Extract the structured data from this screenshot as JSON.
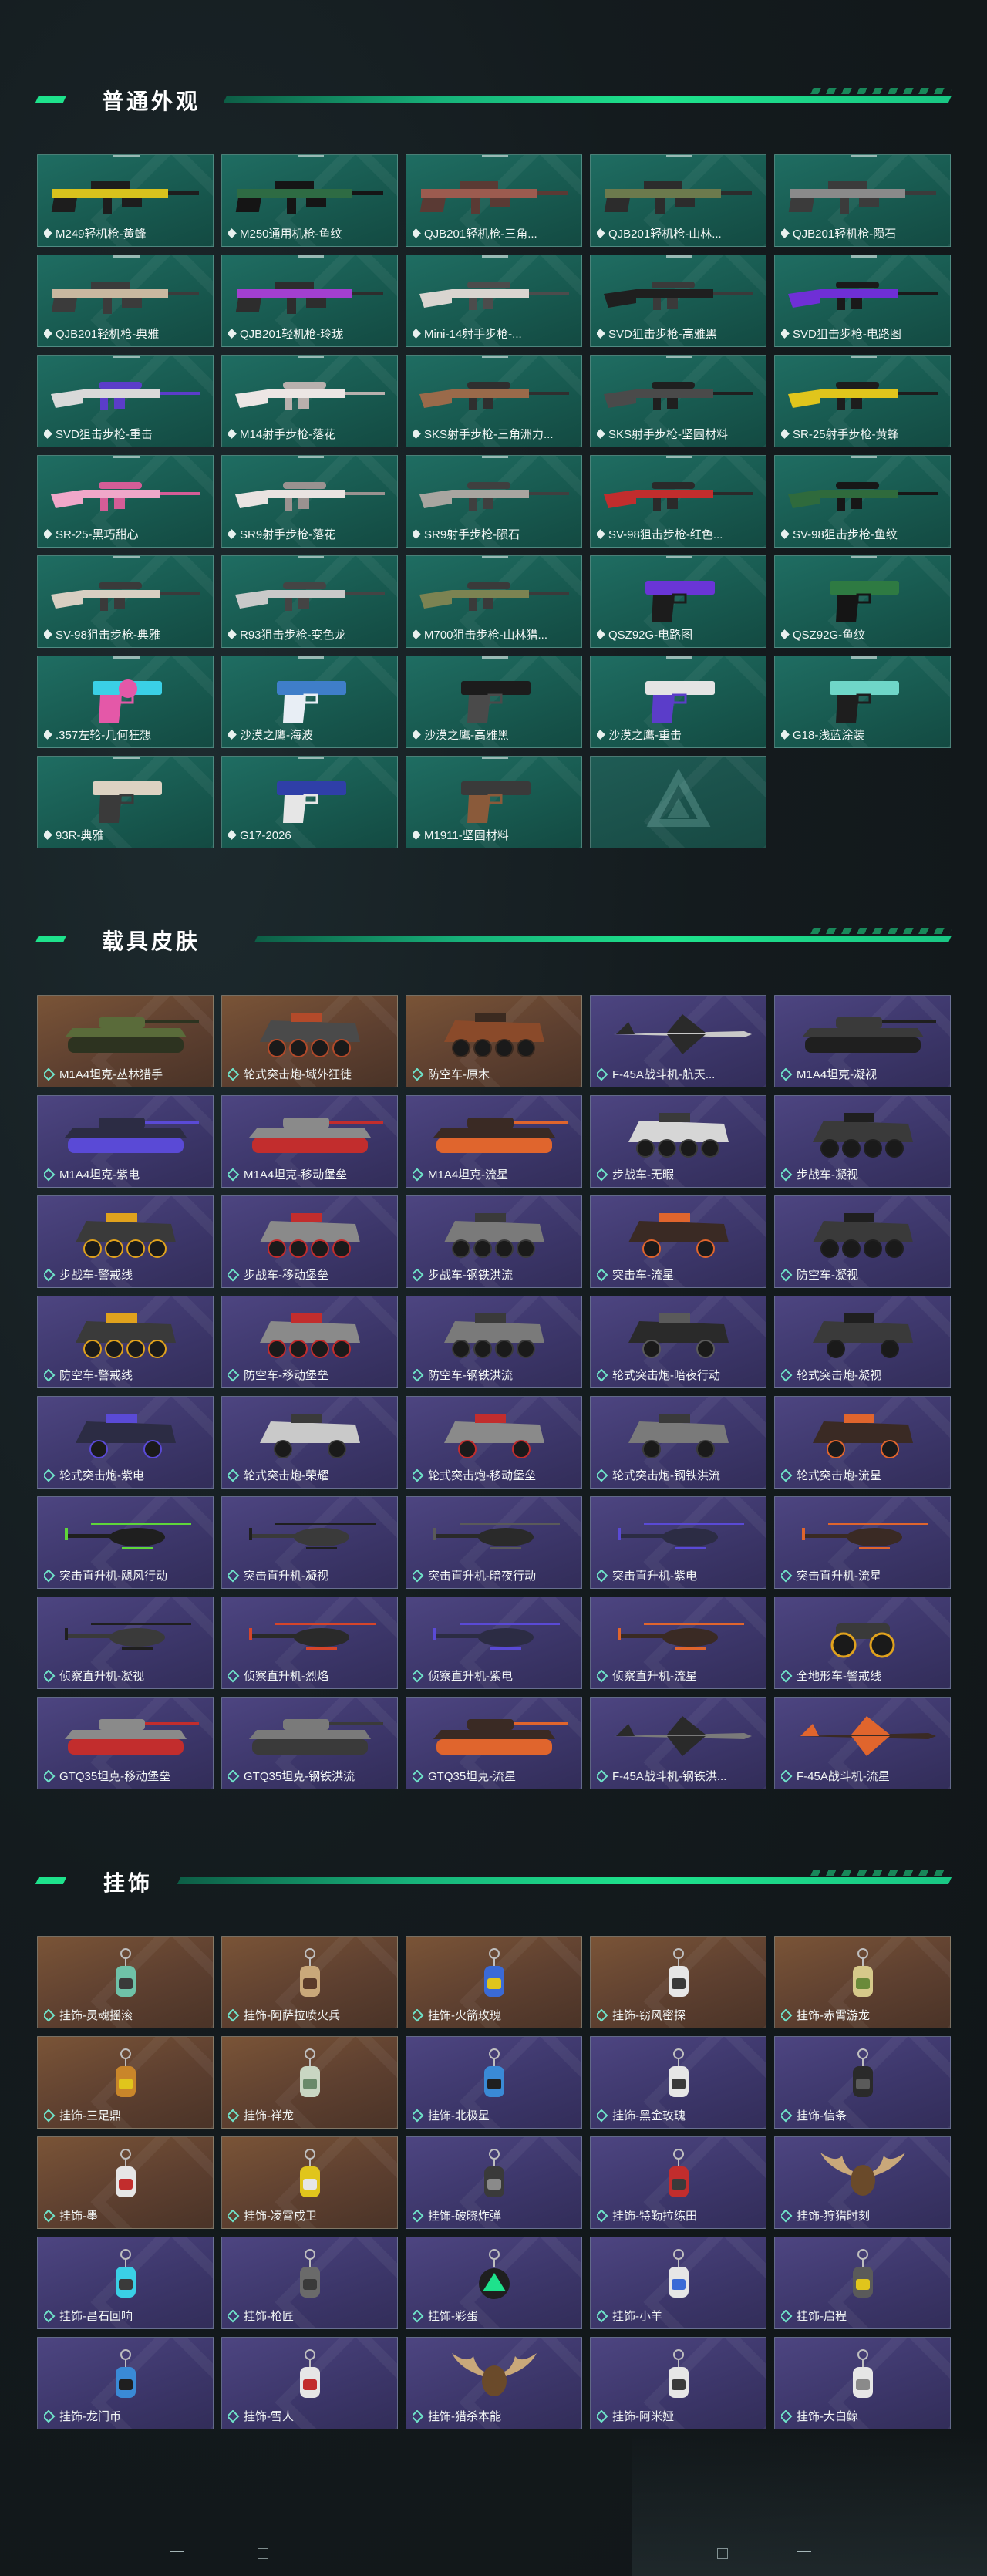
{
  "sections": [
    {
      "title": "普通外观",
      "items": [
        {
          "label": "M249轻机枪-黄蜂",
          "kind": "gun-long",
          "colors": [
            "#d8c21d",
            "#1d1d1d"
          ]
        },
        {
          "label": "M250通用机枪-鱼纹",
          "kind": "gun-long",
          "colors": [
            "#2e6b43",
            "#151515"
          ]
        },
        {
          "label": "QJB201轻机枪-三角...",
          "kind": "gun-long",
          "colors": [
            "#9c5b4f",
            "#5a3a34"
          ]
        },
        {
          "label": "QJB201轻机枪-山林...",
          "kind": "gun-long",
          "colors": [
            "#6c7a4d",
            "#2c2c2c"
          ]
        },
        {
          "label": "QJB201轻机枪-陨石",
          "kind": "gun-long",
          "colors": [
            "#8a8a8a",
            "#3b3b3b"
          ]
        },
        {
          "label": "QJB201轻机枪-典雅",
          "kind": "gun-long",
          "colors": [
            "#c9b8a0",
            "#3b3b3b"
          ]
        },
        {
          "label": "QJB201轻机枪-玲珑",
          "kind": "gun-long",
          "colors": [
            "#a33fd0",
            "#2d2d2d"
          ]
        },
        {
          "label": "Mini-14射手步枪-...",
          "kind": "gun-rifle",
          "colors": [
            "#d9d5d0",
            "#4c4c4c"
          ]
        },
        {
          "label": "SVD狙击步枪-高雅黑",
          "kind": "gun-rifle",
          "colors": [
            "#1f1f1f",
            "#3a3a3a"
          ]
        },
        {
          "label": "SVD狙击步枪-电路图",
          "kind": "gun-rifle",
          "colors": [
            "#6f2fd6",
            "#1a1a1a"
          ]
        },
        {
          "label": "SVD狙击步枪-重击",
          "kind": "gun-rifle",
          "colors": [
            "#d9d9d9",
            "#5b3dc9"
          ]
        },
        {
          "label": "M14射手步枪-落花",
          "kind": "gun-rifle",
          "colors": [
            "#ece6e4",
            "#b8b0ad"
          ]
        },
        {
          "label": "SKS射手步枪-三角洲力...",
          "kind": "gun-rifle",
          "colors": [
            "#9a6a4a",
            "#2f2f2f"
          ]
        },
        {
          "label": "SKS射手步枪-坚固材料",
          "kind": "gun-rifle",
          "colors": [
            "#4a4a4a",
            "#1f1f1f"
          ]
        },
        {
          "label": "SR-25射手步枪-黄蜂",
          "kind": "gun-rifle",
          "colors": [
            "#e0c51c",
            "#1d1d1d"
          ]
        },
        {
          "label": "SR-25-黑巧甜心",
          "kind": "gun-rifle",
          "colors": [
            "#f0a7c9",
            "#d45d97"
          ]
        },
        {
          "label": "SR9射手步枪-落花",
          "kind": "gun-rifle",
          "colors": [
            "#e9e3e1",
            "#9a9290"
          ]
        },
        {
          "label": "SR9射手步枪-陨石",
          "kind": "gun-rifle",
          "colors": [
            "#a8a5a0",
            "#3f3f3f"
          ]
        },
        {
          "label": "SV-98狙击步枪-红色...",
          "kind": "gun-rifle",
          "colors": [
            "#c22d2d",
            "#2a2a2a"
          ]
        },
        {
          "label": "SV-98狙击步枪-鱼纹",
          "kind": "gun-rifle",
          "colors": [
            "#2f6a3c",
            "#171717"
          ]
        },
        {
          "label": "SV-98狙击步枪-典雅",
          "kind": "gun-rifle",
          "colors": [
            "#d8cfc2",
            "#3a3a3a"
          ]
        },
        {
          "label": "R93狙击步枪-变色龙",
          "kind": "gun-rifle",
          "colors": [
            "#c9c9c9",
            "#444444"
          ]
        },
        {
          "label": "M700狙击步枪-山林猎...",
          "kind": "gun-rifle",
          "colors": [
            "#7c8352",
            "#3a3a3a"
          ]
        },
        {
          "label": "QSZ92G-电路图",
          "kind": "gun-pistol",
          "colors": [
            "#6a35d6",
            "#1c1c1c"
          ]
        },
        {
          "label": "QSZ92G-鱼纹",
          "kind": "gun-pistol",
          "colors": [
            "#2e7a42",
            "#151515"
          ]
        },
        {
          "label": ".357左轮-几何狂想",
          "kind": "gun-revolver",
          "colors": [
            "#3ad0e6",
            "#e458a8"
          ]
        },
        {
          "label": "沙漠之鹰-海波",
          "kind": "gun-pistol",
          "colors": [
            "#3f7ec9",
            "#e8eef5"
          ]
        },
        {
          "label": "沙漠之鹰-高雅黑",
          "kind": "gun-pistol",
          "colors": [
            "#1c1c1c",
            "#4a4a4a"
          ]
        },
        {
          "label": "沙漠之鹰-重击",
          "kind": "gun-pistol",
          "colors": [
            "#e4e4e4",
            "#5b3dc9"
          ]
        },
        {
          "label": "G18-浅蓝涂装",
          "kind": "gun-pistol",
          "colors": [
            "#6fd6c8",
            "#1e1e1e"
          ]
        },
        {
          "label": "93R-典雅",
          "kind": "gun-pistol",
          "colors": [
            "#ddd2c2",
            "#3a3a3a"
          ]
        },
        {
          "label": "G17-2026",
          "kind": "gun-pistol",
          "colors": [
            "#2f3fa8",
            "#e6e6e6"
          ]
        },
        {
          "label": "M1911-坚固材料",
          "kind": "gun-pistol",
          "colors": [
            "#3a3a3a",
            "#8a5a3a"
          ]
        },
        {
          "label": "",
          "kind": "empty",
          "colors": [
            "#9fd9cf",
            "#9fd9cf"
          ]
        }
      ]
    },
    {
      "title": "载具皮肤",
      "items": [
        {
          "label": "M1A4坦克-丛林猎手",
          "kind": "tank",
          "bg": "orange",
          "colors": [
            "#5a6b3a",
            "#2d3320"
          ]
        },
        {
          "label": "轮式突击炮-域外狂徒",
          "kind": "apc",
          "bg": "orange",
          "colors": [
            "#4a4a4a",
            "#b34a2a"
          ]
        },
        {
          "label": "防空车-原木",
          "kind": "apc",
          "bg": "orange",
          "colors": [
            "#8a4a2a",
            "#3b2a20"
          ]
        },
        {
          "label": "F-45A战斗机-航天...",
          "kind": "jet",
          "bg": "purple",
          "colors": [
            "#c9c9c9",
            "#2a2a2a"
          ]
        },
        {
          "label": "M1A4坦克-凝视",
          "kind": "tank",
          "bg": "purple",
          "colors": [
            "#3a3a3a",
            "#1f1f1f"
          ]
        },
        {
          "label": "M1A4坦克-紫电",
          "kind": "tank",
          "bg": "purple",
          "colors": [
            "#2c2c44",
            "#5a4ad6"
          ]
        },
        {
          "label": "M1A4坦克-移动堡垒",
          "kind": "tank",
          "bg": "purple",
          "colors": [
            "#8a8a8a",
            "#c22d2d"
          ]
        },
        {
          "label": "M1A4坦克-流星",
          "kind": "tank",
          "bg": "purple",
          "colors": [
            "#3a2a24",
            "#e0652d"
          ]
        },
        {
          "label": "步战车-无暇",
          "kind": "apc",
          "bg": "purple",
          "colors": [
            "#d6d6d6",
            "#3a3a3a"
          ]
        },
        {
          "label": "步战车-凝视",
          "kind": "apc",
          "bg": "purple",
          "colors": [
            "#3a3a3a",
            "#1f1f1f"
          ]
        },
        {
          "label": "步战车-警戒线",
          "kind": "apc",
          "bg": "purple",
          "colors": [
            "#3a3a3a",
            "#e0a21d"
          ]
        },
        {
          "label": "步战车-移动堡垒",
          "kind": "apc",
          "bg": "purple",
          "colors": [
            "#8a8a8a",
            "#c22d2d"
          ]
        },
        {
          "label": "步战车-钢铁洪流",
          "kind": "apc",
          "bg": "purple",
          "colors": [
            "#7a7a7a",
            "#3a3a3a"
          ]
        },
        {
          "label": "突击车-流星",
          "kind": "truck",
          "bg": "purple",
          "colors": [
            "#3a2a24",
            "#e0652d"
          ]
        },
        {
          "label": "防空车-凝视",
          "kind": "apc",
          "bg": "purple",
          "colors": [
            "#3a3a3a",
            "#1f1f1f"
          ]
        },
        {
          "label": "防空车-警戒线",
          "kind": "apc",
          "bg": "purple",
          "colors": [
            "#3a3a3a",
            "#e0a21d"
          ]
        },
        {
          "label": "防空车-移动堡垒",
          "kind": "apc",
          "bg": "purple",
          "colors": [
            "#8a8a8a",
            "#c22d2d"
          ]
        },
        {
          "label": "防空车-钢铁洪流",
          "kind": "apc",
          "bg": "purple",
          "colors": [
            "#7a7a7a",
            "#3a3a3a"
          ]
        },
        {
          "label": "轮式突击炮-暗夜行动",
          "kind": "truck",
          "bg": "purple",
          "colors": [
            "#2a2a2a",
            "#5a5a5a"
          ]
        },
        {
          "label": "轮式突击炮-凝视",
          "kind": "truck",
          "bg": "purple",
          "colors": [
            "#3a3a3a",
            "#1f1f1f"
          ]
        },
        {
          "label": "轮式突击炮-紫电",
          "kind": "truck",
          "bg": "purple",
          "colors": [
            "#2c2c44",
            "#5a4ad6"
          ]
        },
        {
          "label": "轮式突击炮-荣耀",
          "kind": "truck",
          "bg": "purple",
          "colors": [
            "#c9c9c9",
            "#3a3a3a"
          ]
        },
        {
          "label": "轮式突击炮-移动堡垒",
          "kind": "truck",
          "bg": "purple",
          "colors": [
            "#8a8a8a",
            "#c22d2d"
          ]
        },
        {
          "label": "轮式突击炮-钢铁洪流",
          "kind": "truck",
          "bg": "purple",
          "colors": [
            "#7a7a7a",
            "#3a3a3a"
          ]
        },
        {
          "label": "轮式突击炮-流星",
          "kind": "truck",
          "bg": "purple",
          "colors": [
            "#3a2a24",
            "#e0652d"
          ]
        },
        {
          "label": "突击直升机-飓风行动",
          "kind": "heli",
          "bg": "purple",
          "colors": [
            "#1f1f1f",
            "#5fd63a"
          ]
        },
        {
          "label": "突击直升机-凝视",
          "kind": "heli",
          "bg": "purple",
          "colors": [
            "#3a3a3a",
            "#1f1f1f"
          ]
        },
        {
          "label": "突击直升机-暗夜行动",
          "kind": "heli",
          "bg": "purple",
          "colors": [
            "#2a2a2a",
            "#5a5a5a"
          ]
        },
        {
          "label": "突击直升机-紫电",
          "kind": "heli",
          "bg": "purple",
          "colors": [
            "#2c2c44",
            "#5a4ad6"
          ]
        },
        {
          "label": "突击直升机-流星",
          "kind": "heli",
          "bg": "purple",
          "colors": [
            "#3a2a24",
            "#e0652d"
          ]
        },
        {
          "label": "侦察直升机-凝视",
          "kind": "heli-small",
          "bg": "purple",
          "colors": [
            "#3a3a3a",
            "#1f1f1f"
          ]
        },
        {
          "label": "侦察直升机-烈焰",
          "kind": "heli-small",
          "bg": "purple",
          "colors": [
            "#2a2a2a",
            "#d6452a"
          ]
        },
        {
          "label": "侦察直升机-紫电",
          "kind": "heli-small",
          "bg": "purple",
          "colors": [
            "#2c2c44",
            "#5a4ad6"
          ]
        },
        {
          "label": "侦察直升机-流星",
          "kind": "heli-small",
          "bg": "purple",
          "colors": [
            "#3a2a24",
            "#e0652d"
          ]
        },
        {
          "label": "全地形车-警戒线",
          "kind": "atv",
          "bg": "purple",
          "colors": [
            "#3a3a3a",
            "#e0a21d"
          ]
        },
        {
          "label": "GTQ35坦克-移动堡垒",
          "kind": "tank",
          "bg": "purple",
          "colors": [
            "#8a8a8a",
            "#c22d2d"
          ]
        },
        {
          "label": "GTQ35坦克-钢铁洪流",
          "kind": "tank",
          "bg": "purple",
          "colors": [
            "#7a7a7a",
            "#3a3a3a"
          ]
        },
        {
          "label": "GTQ35坦克-流星",
          "kind": "tank",
          "bg": "purple",
          "colors": [
            "#3a2a24",
            "#e0652d"
          ]
        },
        {
          "label": "F-45A战斗机-钢铁洪...",
          "kind": "jet",
          "bg": "purple",
          "colors": [
            "#7a7a7a",
            "#2a2a2a"
          ]
        },
        {
          "label": "F-45A战斗机-流星",
          "kind": "jet",
          "bg": "purple",
          "colors": [
            "#3a2a24",
            "#e0652d"
          ]
        }
      ]
    },
    {
      "title": "挂饰",
      "items": [
        {
          "label": "挂饰-灵魂摇滚",
          "kind": "charm",
          "bg": "orange",
          "colors": [
            "#6fc2a8",
            "#3a3a3a"
          ]
        },
        {
          "label": "挂饰-阿萨拉喷火兵",
          "kind": "charm",
          "bg": "orange",
          "colors": [
            "#c9a87a",
            "#5a3a2a"
          ]
        },
        {
          "label": "挂饰-火箭玫瑰",
          "kind": "charm",
          "bg": "orange",
          "colors": [
            "#3a6ad6",
            "#e0c51c"
          ]
        },
        {
          "label": "挂饰-窃风密探",
          "kind": "charm",
          "bg": "orange",
          "colors": [
            "#e6e6e6",
            "#3a3a3a"
          ]
        },
        {
          "label": "挂饰-赤霄游龙",
          "kind": "charm",
          "bg": "orange",
          "colors": [
            "#d6c98a",
            "#6a8a3a"
          ]
        },
        {
          "label": "挂饰-三足鼎",
          "kind": "charm",
          "bg": "orange",
          "colors": [
            "#c9862a",
            "#e0c51c"
          ]
        },
        {
          "label": "挂饰-祥龙",
          "kind": "charm",
          "bg": "orange",
          "colors": [
            "#c9d6c2",
            "#6a8a6a"
          ]
        },
        {
          "label": "挂饰-北极星",
          "kind": "charm",
          "bg": "purple",
          "colors": [
            "#3a8ad6",
            "#1f1f1f"
          ]
        },
        {
          "label": "挂饰-黑金玫瑰",
          "kind": "charm",
          "bg": "purple",
          "colors": [
            "#e6e6e6",
            "#3a3a3a"
          ]
        },
        {
          "label": "挂饰-信条",
          "kind": "charm",
          "bg": "purple",
          "colors": [
            "#2a2a2a",
            "#5a5a5a"
          ]
        },
        {
          "label": "挂饰-墨",
          "kind": "charm",
          "bg": "orange",
          "colors": [
            "#e6e6e6",
            "#c22d2d"
          ]
        },
        {
          "label": "挂饰-凌霄戍卫",
          "kind": "charm",
          "bg": "orange",
          "colors": [
            "#e0c51c",
            "#e6e6e6"
          ]
        },
        {
          "label": "挂饰-破晓炸弹",
          "kind": "charm",
          "bg": "purple",
          "colors": [
            "#3a3a3a",
            "#8a8a8a"
          ]
        },
        {
          "label": "挂饰-特勤拉练田",
          "kind": "charm",
          "bg": "purple",
          "colors": [
            "#c22d2d",
            "#3a3a3a"
          ]
        },
        {
          "label": "挂饰-狩猎时刻",
          "kind": "antlers",
          "bg": "purple",
          "colors": [
            "#c9a87a",
            "#6a4a2a"
          ]
        },
        {
          "label": "挂饰-昌石回响",
          "kind": "charm",
          "bg": "purple",
          "colors": [
            "#3ad0e6",
            "#3a3a3a"
          ]
        },
        {
          "label": "挂饰-枪匠",
          "kind": "charm",
          "bg": "purple",
          "colors": [
            "#6a6a6a",
            "#3a3a3a"
          ]
        },
        {
          "label": "挂饰-彩蛋",
          "kind": "charm-tri",
          "bg": "purple",
          "colors": [
            "#1ee28c",
            "#1f1f1f"
          ]
        },
        {
          "label": "挂饰-小羊",
          "kind": "charm",
          "bg": "purple",
          "colors": [
            "#e6e6e6",
            "#3a6ad6"
          ]
        },
        {
          "label": "挂饰-启程",
          "kind": "charm",
          "bg": "purple",
          "colors": [
            "#5a5a5a",
            "#e0c51c"
          ]
        },
        {
          "label": "挂饰-龙门币",
          "kind": "charm",
          "bg": "purple",
          "colors": [
            "#3a8ad6",
            "#1f1f1f"
          ]
        },
        {
          "label": "挂饰-雪人",
          "kind": "charm",
          "bg": "purple",
          "colors": [
            "#e6e6e6",
            "#c22d2d"
          ]
        },
        {
          "label": "挂饰-猎杀本能",
          "kind": "antlers",
          "bg": "purple",
          "colors": [
            "#c9a87a",
            "#6a4a2a"
          ]
        },
        {
          "label": "挂饰-阿米娅",
          "kind": "charm",
          "bg": "purple",
          "colors": [
            "#e6e6e6",
            "#3a3a3a"
          ]
        },
        {
          "label": "挂饰-大白鲸",
          "kind": "charm",
          "bg": "purple",
          "colors": [
            "#e6e6e6",
            "#8a8a8a"
          ]
        }
      ]
    }
  ],
  "accent_color": "#1ee28c"
}
